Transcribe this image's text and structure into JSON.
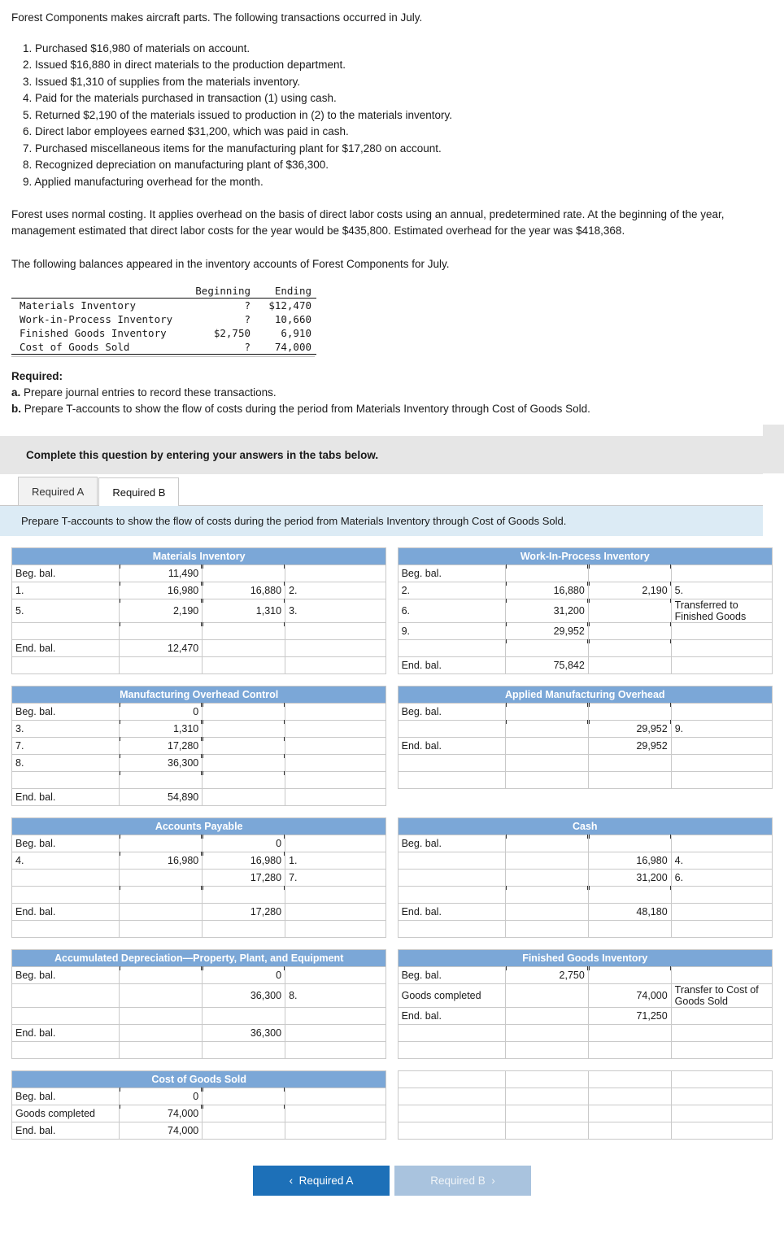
{
  "intro": {
    "line1": "Forest Components makes aircraft parts. The following transactions occurred in July."
  },
  "transactions": [
    "1. Purchased $16,980 of materials on account.",
    "2. Issued $16,880 in direct materials to the production department.",
    "3. Issued $1,310 of supplies from the materials inventory.",
    "4. Paid for the materials purchased in transaction (1) using cash.",
    "5. Returned $2,190 of the materials issued to production in (2) to the materials inventory.",
    "6. Direct labor employees earned $31,200, which was paid in cash.",
    "7. Purchased miscellaneous items for the manufacturing plant for $17,280 on account.",
    "8. Recognized depreciation on manufacturing plant of $36,300.",
    "9. Applied manufacturing overhead for the month."
  ],
  "paragraphs": {
    "costing": "Forest uses normal costing. It applies overhead on the basis of direct labor costs using an annual, predetermined rate. At the beginning of the year, management estimated that direct labor costs for the year would be $435,800. Estimated overhead for the year was $418,368.",
    "balances_intro": "The following balances appeared in the inventory accounts of Forest Components for July."
  },
  "balances": {
    "col_headers": [
      "Beginning",
      "Ending"
    ],
    "rows": [
      {
        "label": "Materials Inventory",
        "beginning": "?",
        "ending": "$12,470"
      },
      {
        "label": "Work-in-Process Inventory",
        "beginning": "?",
        "ending": "10,660"
      },
      {
        "label": "Finished Goods Inventory",
        "beginning": "$2,750",
        "ending": "6,910"
      },
      {
        "label": "Cost of Goods Sold",
        "beginning": "?",
        "ending": "74,000"
      }
    ]
  },
  "required": {
    "title": "Required:",
    "a": "a. Prepare journal entries to record these transactions.",
    "b": "b. Prepare T-accounts to show the flow of costs during the period from Materials Inventory through Cost of Goods Sold."
  },
  "instruction_bar": "Complete this question by entering your answers in the tabs below.",
  "tabs": [
    {
      "label": "Required A",
      "active": false
    },
    {
      "label": "Required B",
      "active": true
    }
  ],
  "prompt": "Prepare T-accounts to show the flow of costs during the period from Materials Inventory through Cost of Goods Sold.",
  "accounts": {
    "materials_inventory": {
      "title": "Materials Inventory",
      "rows": [
        {
          "left_tag": "Beg. bal.",
          "debit": "11,490",
          "credit": "",
          "right_tag": ""
        },
        {
          "left_tag": "1.",
          "debit": "16,980",
          "credit": "16,880",
          "right_tag": "2."
        },
        {
          "left_tag": "5.",
          "debit": "2,190",
          "credit": "1,310",
          "right_tag": "3."
        },
        {
          "left_tag": "",
          "debit": "",
          "credit": "",
          "right_tag": ""
        },
        {
          "left_tag": "End. bal.",
          "debit": "12,470",
          "credit": "",
          "right_tag": ""
        },
        {
          "left_tag": "",
          "debit": "",
          "credit": "",
          "right_tag": ""
        }
      ]
    },
    "wip_inventory": {
      "title": "Work-In-Process Inventory",
      "rows": [
        {
          "left_tag": "Beg. bal.",
          "debit": "",
          "credit": "",
          "right_tag": ""
        },
        {
          "left_tag": "2.",
          "debit": "16,880",
          "credit": "2,190",
          "right_tag": "5."
        },
        {
          "left_tag": "6.",
          "debit": "31,200",
          "credit": "",
          "right_tag": "Transferred to Finished Goods"
        },
        {
          "left_tag": "9.",
          "debit": "29,952",
          "credit": "",
          "right_tag": ""
        },
        {
          "left_tag": "",
          "debit": "",
          "credit": "",
          "right_tag": ""
        },
        {
          "left_tag": "End. bal.",
          "debit": "75,842",
          "credit": "",
          "right_tag": ""
        }
      ]
    },
    "moh_control": {
      "title": "Manufacturing Overhead Control",
      "rows": [
        {
          "left_tag": "Beg. bal.",
          "debit": "0",
          "credit": "",
          "right_tag": ""
        },
        {
          "left_tag": "3.",
          "debit": "1,310",
          "credit": "",
          "right_tag": ""
        },
        {
          "left_tag": "7.",
          "debit": "17,280",
          "credit": "",
          "right_tag": ""
        },
        {
          "left_tag": "8.",
          "debit": "36,300",
          "credit": "",
          "right_tag": ""
        },
        {
          "left_tag": "",
          "debit": "",
          "credit": "",
          "right_tag": ""
        },
        {
          "left_tag": "End. bal.",
          "debit": "54,890",
          "credit": "",
          "right_tag": ""
        }
      ]
    },
    "applied_moh": {
      "title": "Applied Manufacturing Overhead",
      "rows": [
        {
          "left_tag": "Beg. bal.",
          "debit": "",
          "credit": "",
          "right_tag": ""
        },
        {
          "left_tag": "",
          "debit": "",
          "credit": "29,952",
          "right_tag": "9."
        },
        {
          "left_tag": "End. bal.",
          "debit": "",
          "credit": "29,952",
          "right_tag": ""
        },
        {
          "left_tag": "",
          "debit": "",
          "credit": "",
          "right_tag": ""
        },
        {
          "left_tag": "",
          "debit": "",
          "credit": "",
          "right_tag": ""
        }
      ]
    },
    "accounts_payable": {
      "title": "Accounts Payable",
      "rows": [
        {
          "left_tag": "Beg. bal.",
          "debit": "",
          "credit": "0",
          "right_tag": ""
        },
        {
          "left_tag": "4.",
          "debit": "16,980",
          "credit": "16,980",
          "right_tag": "1."
        },
        {
          "left_tag": "",
          "debit": "",
          "credit": "17,280",
          "right_tag": "7."
        },
        {
          "left_tag": "",
          "debit": "",
          "credit": "",
          "right_tag": ""
        },
        {
          "left_tag": "End. bal.",
          "debit": "",
          "credit": "17,280",
          "right_tag": ""
        },
        {
          "left_tag": "",
          "debit": "",
          "credit": "",
          "right_tag": ""
        }
      ]
    },
    "cash": {
      "title": "Cash",
      "rows": [
        {
          "left_tag": "Beg. bal.",
          "debit": "",
          "credit": "",
          "right_tag": ""
        },
        {
          "left_tag": "",
          "debit": "",
          "credit": "16,980",
          "right_tag": "4."
        },
        {
          "left_tag": "",
          "debit": "",
          "credit": "31,200",
          "right_tag": "6."
        },
        {
          "left_tag": "",
          "debit": "",
          "credit": "",
          "right_tag": ""
        },
        {
          "left_tag": "End. bal.",
          "debit": "",
          "credit": "48,180",
          "right_tag": ""
        },
        {
          "left_tag": "",
          "debit": "",
          "credit": "",
          "right_tag": ""
        }
      ]
    },
    "accum_depr": {
      "title": "Accumulated Depreciation—Property, Plant, and Equipment",
      "rows": [
        {
          "left_tag": "Beg. bal.",
          "debit": "",
          "credit": "0",
          "right_tag": ""
        },
        {
          "left_tag": "",
          "debit": "",
          "credit": "36,300",
          "right_tag": "8."
        },
        {
          "left_tag": "",
          "debit": "",
          "credit": "",
          "right_tag": ""
        },
        {
          "left_tag": "End. bal.",
          "debit": "",
          "credit": "36,300",
          "right_tag": ""
        },
        {
          "left_tag": "",
          "debit": "",
          "credit": "",
          "right_tag": ""
        }
      ]
    },
    "finished_goods": {
      "title": "Finished Goods Inventory",
      "rows": [
        {
          "left_tag": "Beg. bal.",
          "debit": "2,750",
          "credit": "",
          "right_tag": ""
        },
        {
          "left_tag": "Goods completed",
          "debit": "",
          "credit": "74,000",
          "right_tag": "Transfer to Cost of Goods Sold"
        },
        {
          "left_tag": "End. bal.",
          "debit": "",
          "credit": "71,250",
          "right_tag": ""
        },
        {
          "left_tag": "",
          "debit": "",
          "credit": "",
          "right_tag": ""
        },
        {
          "left_tag": "",
          "debit": "",
          "credit": "",
          "right_tag": ""
        },
        {
          "left_tag": "",
          "debit": "",
          "credit": "",
          "right_tag": ""
        }
      ]
    },
    "cogs": {
      "title": "Cost of Goods Sold",
      "rows": [
        {
          "left_tag": "Beg. bal.",
          "debit": "0",
          "credit": "",
          "right_tag": ""
        },
        {
          "left_tag": "Goods completed",
          "debit": "74,000",
          "credit": "",
          "right_tag": ""
        },
        {
          "left_tag": "End. bal.",
          "debit": "74,000",
          "credit": "",
          "right_tag": ""
        }
      ]
    }
  },
  "footer": {
    "prev_label": "Required A",
    "next_label": "Required B",
    "prev_icon": "chevron-left-icon",
    "next_icon": "chevron-right-icon"
  },
  "colors": {
    "header_blue": "#7ba7d7",
    "prompt_blue": "#dcebf5",
    "button_blue": "#1d70b8",
    "gray_bar": "#e6e6e6"
  }
}
